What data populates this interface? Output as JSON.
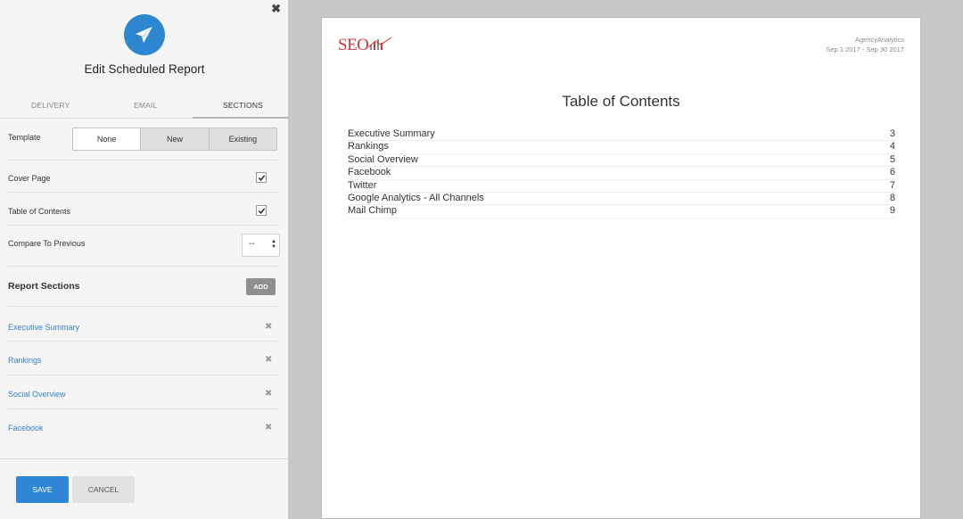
{
  "panel": {
    "close_glyph": "✖",
    "icon": "paper-plane-icon",
    "title": "Edit Scheduled Report",
    "tabs": [
      {
        "label": "DELIVERY"
      },
      {
        "label": "EMAIL"
      },
      {
        "label": "SECTIONS",
        "active": true
      }
    ],
    "template": {
      "label": "Template",
      "options": [
        "None",
        "New",
        "Existing"
      ],
      "selected": "None"
    },
    "cover_page": {
      "label": "Cover Page",
      "checked": true
    },
    "table_of_contents": {
      "label": "Table of Contents",
      "checked": true
    },
    "compare_to_previous": {
      "label": "Compare To Previous",
      "value": "--"
    },
    "report_sections": {
      "heading": "Report Sections",
      "add_label": "ADD",
      "items": [
        {
          "label": "Executive Summary"
        },
        {
          "label": "Rankings"
        },
        {
          "label": "Social Overview"
        },
        {
          "label": "Facebook"
        }
      ],
      "remove_glyph": "✖"
    },
    "footer": {
      "save_label": "SAVE",
      "cancel_label": "CANCEL"
    },
    "colors": {
      "accent": "#2e86d4",
      "link": "#3a7fc4"
    }
  },
  "document": {
    "logo_text": "SEO",
    "company": "AgencyAnalytics",
    "date_range": "Sep 1 2017 - Sep 30 2017",
    "title": "Table of Contents",
    "toc": [
      {
        "name": "Executive Summary",
        "page": "3"
      },
      {
        "name": "Rankings",
        "page": "4"
      },
      {
        "name": "Social Overview",
        "page": "5"
      },
      {
        "name": "Facebook",
        "page": "6"
      },
      {
        "name": "Twitter",
        "page": "7"
      },
      {
        "name": "Google Analytics - All Channels",
        "page": "8"
      },
      {
        "name": "Mail Chimp",
        "page": "9"
      }
    ],
    "logo_color": "#d2353c"
  }
}
